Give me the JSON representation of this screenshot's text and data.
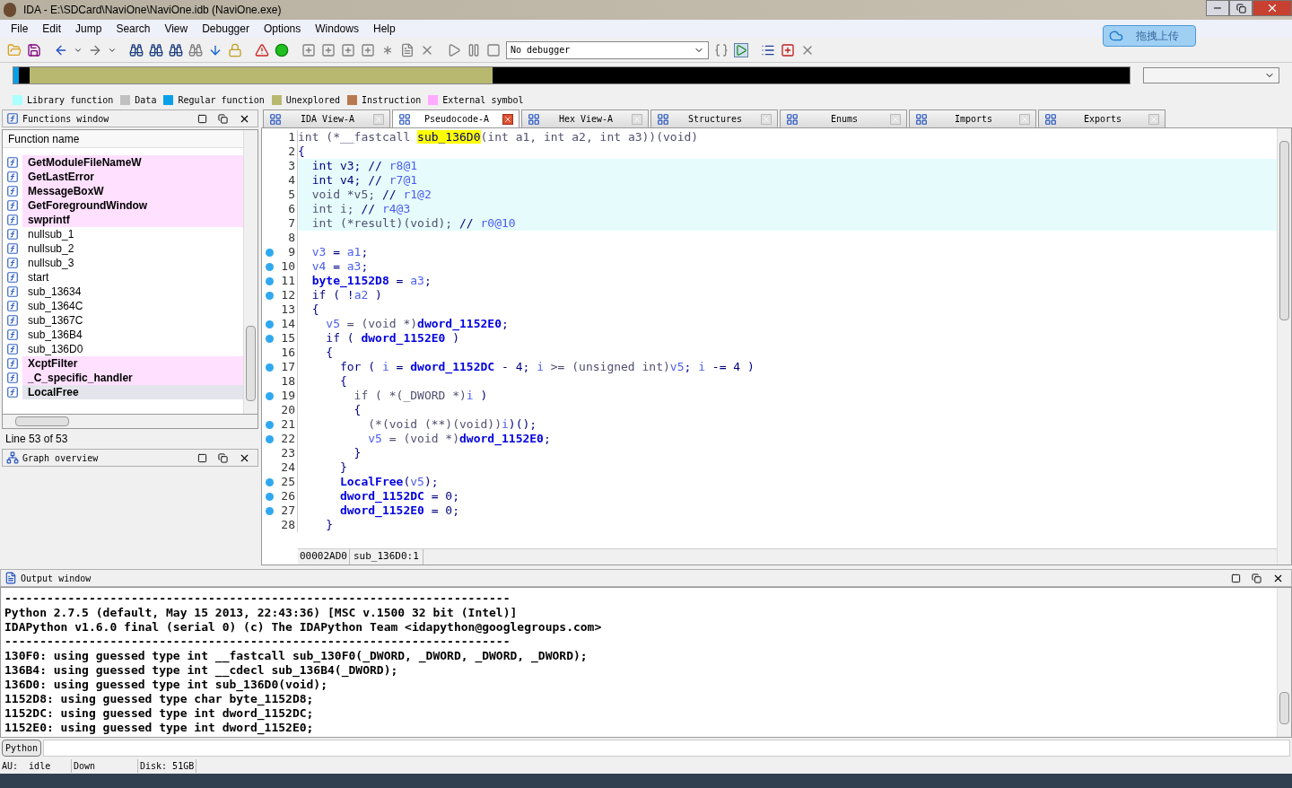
{
  "window": {
    "title": "IDA - E:\\SDCard\\NaviOne\\NaviOne.idb (NaviOne.exe)"
  },
  "menu": [
    "File",
    "Edit",
    "Jump",
    "Search",
    "View",
    "Debugger",
    "Options",
    "Windows",
    "Help"
  ],
  "upload_button": "拖拽上传",
  "toolbar": {
    "debugger_select": "No debugger"
  },
  "legend": [
    {
      "label": "Library function",
      "color": "#aaffff"
    },
    {
      "label": "Data",
      "color": "#c0c0c0"
    },
    {
      "label": "Regular function",
      "color": "#0aa0e8"
    },
    {
      "label": "Unexplored",
      "color": "#b8b870"
    },
    {
      "label": "Instruction",
      "color": "#b87850"
    },
    {
      "label": "External symbol",
      "color": "#ffaaff"
    }
  ],
  "functions_window": {
    "title": "Functions window",
    "column": "Function name",
    "status": "Line 53 of 53",
    "items": [
      {
        "name": "GetModuleFileNameW",
        "kind": "import",
        "selected": false
      },
      {
        "name": "GetLastError",
        "kind": "import",
        "selected": false
      },
      {
        "name": "MessageBoxW",
        "kind": "import",
        "selected": false
      },
      {
        "name": "GetForegroundWindow",
        "kind": "import",
        "selected": false
      },
      {
        "name": "swprintf",
        "kind": "import",
        "selected": false
      },
      {
        "name": "nullsub_1",
        "kind": "regular",
        "selected": false
      },
      {
        "name": "nullsub_2",
        "kind": "regular",
        "selected": false
      },
      {
        "name": "nullsub_3",
        "kind": "regular",
        "selected": false
      },
      {
        "name": "start",
        "kind": "regular",
        "selected": false
      },
      {
        "name": "sub_13634",
        "kind": "regular",
        "selected": false
      },
      {
        "name": "sub_1364C",
        "kind": "regular",
        "selected": false
      },
      {
        "name": "sub_1367C",
        "kind": "regular",
        "selected": false
      },
      {
        "name": "sub_136B4",
        "kind": "regular",
        "selected": false
      },
      {
        "name": "sub_136D0",
        "kind": "regular",
        "selected": false
      },
      {
        "name": "XcptFilter",
        "kind": "import",
        "selected": false
      },
      {
        "name": "_C_specific_handler",
        "kind": "import",
        "selected": false
      },
      {
        "name": "LocalFree",
        "kind": "import",
        "selected": true
      }
    ]
  },
  "graph_overview": {
    "title": "Graph overview"
  },
  "tabs": [
    {
      "label": "IDA View-A",
      "selected": false
    },
    {
      "label": "Pseudocode-A",
      "selected": true
    },
    {
      "label": "Hex View-A",
      "selected": false
    },
    {
      "label": "Structures",
      "selected": false
    },
    {
      "label": "Enums",
      "selected": false
    },
    {
      "label": "Imports",
      "selected": false
    },
    {
      "label": "Exports",
      "selected": false
    }
  ],
  "pseudocode": {
    "status_address": "00002AD0",
    "status_location": "sub_136D0:1",
    "lines": [
      {
        "n": "1",
        "breakpoint": false,
        "declaration": false,
        "tokens": [
          {
            "text": "int (*__fastcall ",
            "kind": "type"
          },
          {
            "text": "sub_136D0",
            "kind": "highlight"
          },
          {
            "text": "(int a1, int a2, int a3))(void)",
            "kind": "type"
          }
        ]
      },
      {
        "n": "2",
        "breakpoint": false,
        "declaration": false,
        "tokens": [
          {
            "text": "{",
            "kind": "plain"
          }
        ]
      },
      {
        "n": "3",
        "breakpoint": false,
        "declaration": true,
        "tokens": [
          {
            "text": "  int v3; // ",
            "kind": "plain"
          },
          {
            "text": "r8@1",
            "kind": "comment"
          }
        ]
      },
      {
        "n": "4",
        "breakpoint": false,
        "declaration": true,
        "tokens": [
          {
            "text": "  int v4; // ",
            "kind": "plain"
          },
          {
            "text": "r7@1",
            "kind": "comment"
          }
        ]
      },
      {
        "n": "5",
        "breakpoint": false,
        "declaration": true,
        "tokens": [
          {
            "text": "  void *v5; ",
            "kind": "type"
          },
          {
            "text": "// ",
            "kind": "plain"
          },
          {
            "text": "r1@2",
            "kind": "comment"
          }
        ]
      },
      {
        "n": "6",
        "breakpoint": false,
        "declaration": true,
        "tokens": [
          {
            "text": "  int i; ",
            "kind": "type"
          },
          {
            "text": "// ",
            "kind": "plain"
          },
          {
            "text": "r4@3",
            "kind": "comment"
          }
        ]
      },
      {
        "n": "7",
        "breakpoint": false,
        "declaration": true,
        "tokens": [
          {
            "text": "  int (*result)(void); ",
            "kind": "type"
          },
          {
            "text": "// ",
            "kind": "plain"
          },
          {
            "text": "r0@10",
            "kind": "comment"
          }
        ]
      },
      {
        "n": "8",
        "breakpoint": false,
        "declaration": false
      },
      {
        "n": "9",
        "breakpoint": true,
        "declaration": false,
        "tokens": [
          {
            "text": "  v3",
            "kind": "local"
          },
          {
            "text": " = ",
            "kind": "plain"
          },
          {
            "text": "a1",
            "kind": "local"
          },
          {
            "text": ";",
            "kind": "plain"
          }
        ]
      },
      {
        "n": "10",
        "breakpoint": true,
        "declaration": false,
        "tokens": [
          {
            "text": "  v4",
            "kind": "local"
          },
          {
            "text": " = ",
            "kind": "plain"
          },
          {
            "text": "a3",
            "kind": "local"
          },
          {
            "text": ";",
            "kind": "plain"
          }
        ]
      },
      {
        "n": "11",
        "breakpoint": true,
        "declaration": false,
        "tokens": [
          {
            "text": "  byte_1152D8",
            "kind": "global"
          },
          {
            "text": " = ",
            "kind": "plain"
          },
          {
            "text": "a3",
            "kind": "local"
          },
          {
            "text": ";",
            "kind": "plain"
          }
        ]
      },
      {
        "n": "12",
        "breakpoint": true,
        "declaration": false,
        "tokens": [
          {
            "text": "  if ( !",
            "kind": "plain"
          },
          {
            "text": "a2",
            "kind": "local"
          },
          {
            "text": " )",
            "kind": "plain"
          }
        ]
      },
      {
        "n": "13",
        "breakpoint": false,
        "declaration": false,
        "tokens": [
          {
            "text": "  {",
            "kind": "plain"
          }
        ]
      },
      {
        "n": "14",
        "breakpoint": true,
        "declaration": false,
        "tokens": [
          {
            "text": "    v5",
            "kind": "local"
          },
          {
            "text": " = (void *)",
            "kind": "type"
          },
          {
            "text": "dword_1152E0",
            "kind": "global"
          },
          {
            "text": ";",
            "kind": "plain"
          }
        ]
      },
      {
        "n": "15",
        "breakpoint": true,
        "declaration": false,
        "tokens": [
          {
            "text": "    if ( ",
            "kind": "plain"
          },
          {
            "text": "dword_1152E0",
            "kind": "global"
          },
          {
            "text": " )",
            "kind": "plain"
          }
        ]
      },
      {
        "n": "16",
        "breakpoint": false,
        "declaration": false,
        "tokens": [
          {
            "text": "    {",
            "kind": "plain"
          }
        ]
      },
      {
        "n": "17",
        "breakpoint": true,
        "declaration": false,
        "tokens": [
          {
            "text": "      for ( ",
            "kind": "plain"
          },
          {
            "text": "i",
            "kind": "local"
          },
          {
            "text": " = ",
            "kind": "plain"
          },
          {
            "text": "dword_1152DC",
            "kind": "global"
          },
          {
            "text": " - 4; ",
            "kind": "plain"
          },
          {
            "text": "i",
            "kind": "local"
          },
          {
            "text": " >= (unsigned int)",
            "kind": "type"
          },
          {
            "text": "v5",
            "kind": "local"
          },
          {
            "text": "; ",
            "kind": "plain"
          },
          {
            "text": "i",
            "kind": "local"
          },
          {
            "text": " -= 4 )",
            "kind": "plain"
          }
        ]
      },
      {
        "n": "18",
        "breakpoint": false,
        "declaration": false,
        "tokens": [
          {
            "text": "      {",
            "kind": "plain"
          }
        ]
      },
      {
        "n": "19",
        "breakpoint": true,
        "declaration": false,
        "tokens": [
          {
            "text": "        if ( *(_DWORD *)",
            "kind": "type"
          },
          {
            "text": "i",
            "kind": "local"
          },
          {
            "text": " )",
            "kind": "plain"
          }
        ]
      },
      {
        "n": "20",
        "breakpoint": false,
        "declaration": false,
        "tokens": [
          {
            "text": "        {",
            "kind": "plain"
          }
        ]
      },
      {
        "n": "21",
        "breakpoint": true,
        "declaration": false,
        "tokens": [
          {
            "text": "          (*(void (**)(void))",
            "kind": "type"
          },
          {
            "text": "i",
            "kind": "local"
          },
          {
            "text": ")();",
            "kind": "plain"
          }
        ]
      },
      {
        "n": "22",
        "breakpoint": true,
        "declaration": false,
        "tokens": [
          {
            "text": "          v5",
            "kind": "local"
          },
          {
            "text": " = (void *)",
            "kind": "type"
          },
          {
            "text": "dword_1152E0",
            "kind": "global"
          },
          {
            "text": ";",
            "kind": "plain"
          }
        ]
      },
      {
        "n": "23",
        "breakpoint": false,
        "declaration": false,
        "tokens": [
          {
            "text": "        }",
            "kind": "plain"
          }
        ]
      },
      {
        "n": "24",
        "breakpoint": false,
        "declaration": false,
        "tokens": [
          {
            "text": "      }",
            "kind": "plain"
          }
        ]
      },
      {
        "n": "25",
        "breakpoint": true,
        "declaration": false,
        "tokens": [
          {
            "text": "      LocalFree",
            "kind": "global"
          },
          {
            "text": "(",
            "kind": "plain"
          },
          {
            "text": "v5",
            "kind": "local"
          },
          {
            "text": ");",
            "kind": "plain"
          }
        ]
      },
      {
        "n": "26",
        "breakpoint": true,
        "declaration": false,
        "tokens": [
          {
            "text": "      dword_1152DC",
            "kind": "global"
          },
          {
            "text": " = 0;",
            "kind": "plain"
          }
        ]
      },
      {
        "n": "27",
        "breakpoint": true,
        "declaration": false,
        "tokens": [
          {
            "text": "      dword_1152E0",
            "kind": "global"
          },
          {
            "text": " = 0;",
            "kind": "plain"
          }
        ]
      },
      {
        "n": "28",
        "breakpoint": false,
        "declaration": false,
        "tokens": [
          {
            "text": "    }",
            "kind": "plain"
          }
        ]
      }
    ]
  },
  "output_window": {
    "title": "Output window",
    "lines": [
      "------------------------------------------------------------------------",
      "Python 2.7.5 (default, May 15 2013, 22:43:36) [MSC v.1500 32 bit (Intel)]",
      "IDAPython v1.6.0 final (serial 0) (c) The IDAPython Team <idapython@googlegroups.com>",
      "------------------------------------------------------------------------",
      "130F0: using guessed type int __fastcall sub_130F0(_DWORD, _DWORD, _DWORD, _DWORD);",
      "136B4: using guessed type int __cdecl sub_136B4(_DWORD);",
      "136D0: using guessed type int sub_136D0(void);",
      "1152D8: using guessed type char byte_1152D8;",
      "1152DC: using guessed type int dword_1152DC;",
      "1152E0: using guessed type int dword_1152E0;"
    ]
  },
  "command": {
    "label": "Python"
  },
  "status_bar": [
    "AU:  idle",
    "Down",
    "Disk: 51GB"
  ]
}
